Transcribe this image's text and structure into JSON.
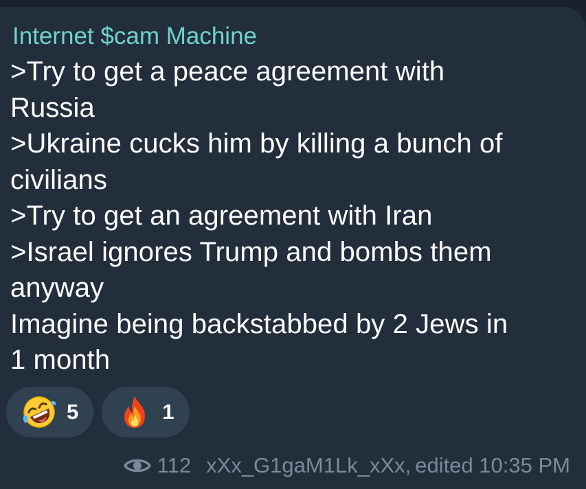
{
  "message": {
    "sender": "Internet $cam Machine",
    "lines": [
      ">Try to get a peace agreement with",
      "Russia",
      ">Ukraine cucks him by killing a bunch of",
      "civilians",
      ">Try to get an agreement with Iran",
      ">Israel ignores Trump and bombs them",
      "anyway",
      "Imagine being backstabbed by 2 Jews in",
      "1 month"
    ]
  },
  "reactions": [
    {
      "icon": "rofl-emoji-icon",
      "count": "5"
    },
    {
      "icon": "fire-emoji-icon",
      "count": "1"
    }
  ],
  "meta": {
    "views_icon": "eye-icon",
    "views": "112",
    "author": "xXx_G1gaM1Lk_xXx,",
    "edited": "edited 10:35 PM"
  },
  "colors": {
    "background": "#18222c",
    "bubble": "#232e3c",
    "sender": "#6fd3c9",
    "text": "#ffffff",
    "reaction_bg": "#304152",
    "meta": "#7b8a99"
  }
}
